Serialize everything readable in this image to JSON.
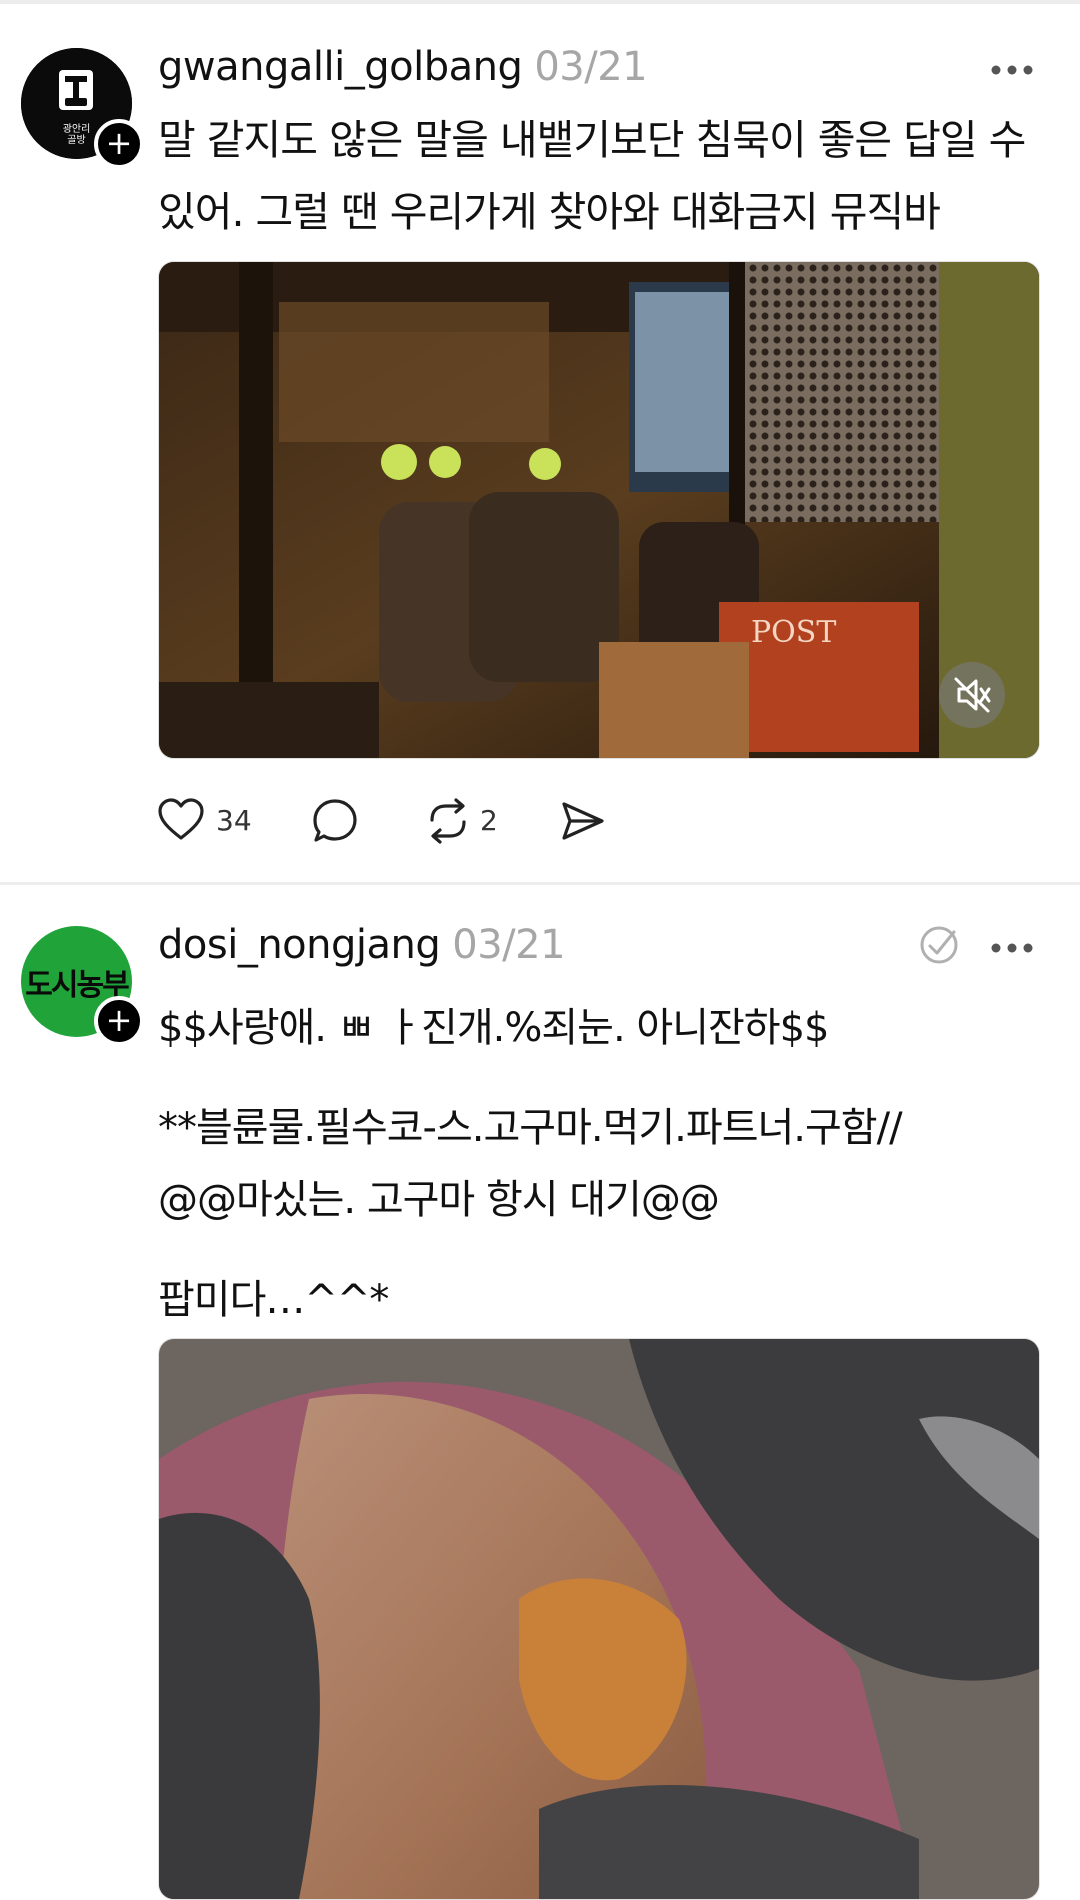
{
  "feed": {
    "posts": [
      {
        "username": "gwangalli_golbang",
        "date": "03/21",
        "avatar_text": "광안리\n골방",
        "text": "말 같지도 않은 말을 내뱉기보단 침묵이 좋은 답일 수 있어. 그럴 땐 우리가게 찾아와 대화금지 뮤직바",
        "text_lines": [
          "말 같지도 않은 말을 내뱉기보단 침묵이 좋은 답일 수",
          "있어. 그럴 땐 우리가게 찾아와 대화금지 뮤직바"
        ],
        "video_sign": "POST",
        "actions": {
          "likes": "34",
          "reposts": "2"
        }
      },
      {
        "username": "dosi_nongjang",
        "date": "03/21",
        "avatar_text": "도시농부",
        "text_lines": [
          "$$사랑애. ㅃ ㅏ진개.%죄눈. 아니잔하$$",
          "**블륜물.필수코-스.고구마.먹기.파트너.구함//",
          "@@마싰는. 고구마 항시 대기@@",
          "팝미다…^^*"
        ]
      }
    ]
  },
  "colors": {
    "divider": "#ededed",
    "date": "#a6a6a6",
    "avatar_2_bg": "#20a43a"
  }
}
